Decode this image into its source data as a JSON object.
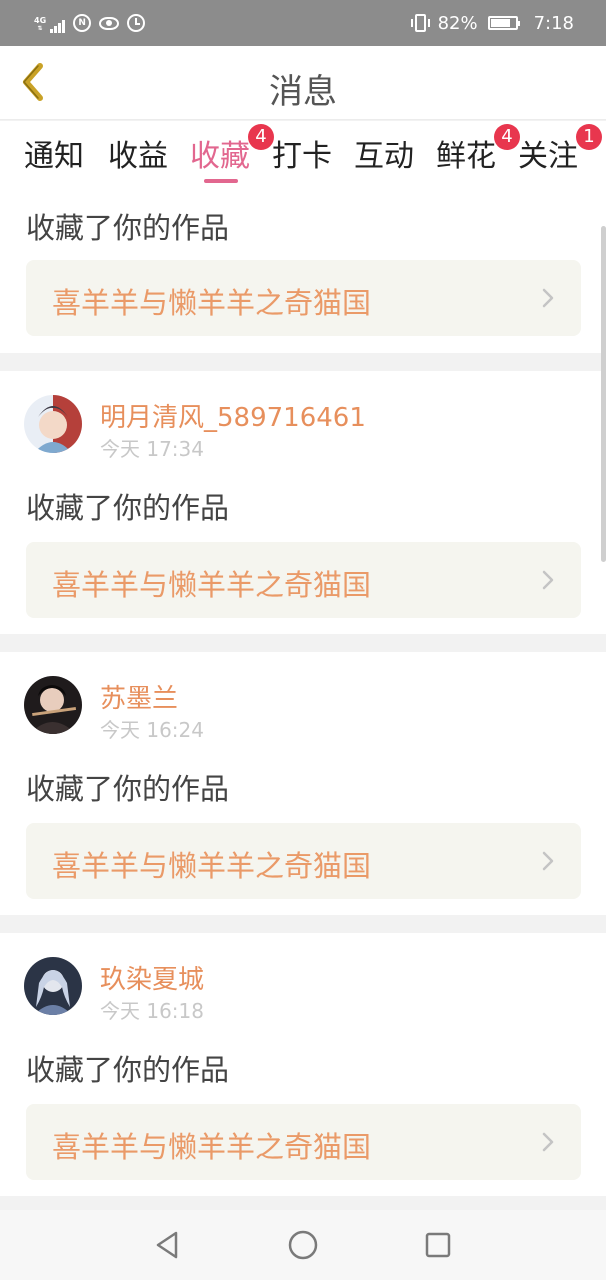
{
  "status_bar": {
    "network": "4G",
    "battery_percent": "82%",
    "battery_level": 0.82,
    "time": "7:18",
    "icons": [
      "signal-icon",
      "nfc-icon",
      "eye-icon",
      "alarm-icon",
      "vibrate-icon",
      "battery-icon"
    ]
  },
  "header": {
    "title": "消息",
    "back_icon": "chevron-left-icon"
  },
  "tabs": [
    {
      "label": "通知",
      "badge": null,
      "active": false
    },
    {
      "label": "收益",
      "badge": null,
      "active": false
    },
    {
      "label": "收藏",
      "badge": "4",
      "active": true
    },
    {
      "label": "打卡",
      "badge": null,
      "active": false
    },
    {
      "label": "互动",
      "badge": null,
      "active": false
    },
    {
      "label": "鲜花",
      "badge": "4",
      "active": false
    },
    {
      "label": "关注",
      "badge": "1",
      "active": false
    }
  ],
  "messages": [
    {
      "user": null,
      "time": null,
      "text": "收藏了你的作品",
      "work_title": "喜羊羊与懒羊羊之奇猫国"
    },
    {
      "user": "明月清风_589716461",
      "time": "今天 17:34",
      "text": "收藏了你的作品",
      "work_title": "喜羊羊与懒羊羊之奇猫国"
    },
    {
      "user": "苏墨兰",
      "time": "今天 16:24",
      "text": "收藏了你的作品",
      "work_title": "喜羊羊与懒羊羊之奇猫国"
    },
    {
      "user": "玖染夏城",
      "time": "今天 16:18",
      "text": "收藏了你的作品",
      "work_title": "喜羊羊与懒羊羊之奇猫国"
    }
  ],
  "colors": {
    "accent": "#e2678f",
    "username": "#e78f5c",
    "work_title": "#ea9a68",
    "badge": "#e8364e",
    "back_arrow": "#c9a227"
  },
  "nav_bar": {
    "icons": [
      "back-triangle-icon",
      "home-circle-icon",
      "recents-square-icon"
    ]
  }
}
